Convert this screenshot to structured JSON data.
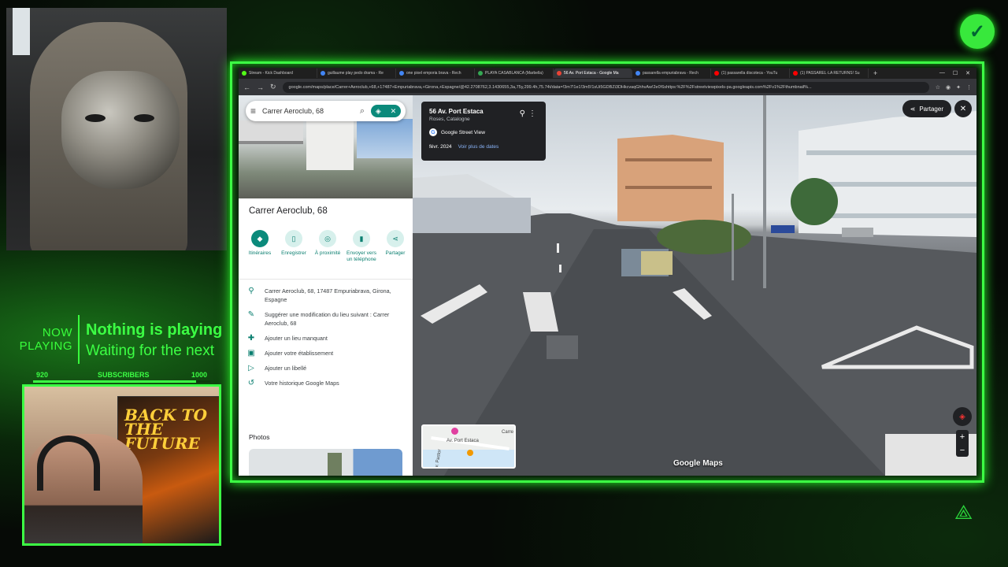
{
  "overlay": {
    "now_playing_label": "NOW PLAYING",
    "now_playing_title": "Nothing is playing",
    "now_playing_sub": "Waiting for the next",
    "subs": {
      "current": "920",
      "label": "SUBSCRIBERS",
      "goal": "1000",
      "progress": 0.92
    },
    "poster_title": "BACK TO THE FUTURE"
  },
  "browser": {
    "tabs": [
      {
        "label": "Stream - Kick Dashboard",
        "color": "#53fc18"
      },
      {
        "label": "guillaume play pedo drama - Re",
        "color": "#4285f4"
      },
      {
        "label": "one pixel emporia brava - Rech",
        "color": "#4285f4"
      },
      {
        "label": "PLAYA CASABLANCA (Marbella)",
        "color": "#34a853"
      },
      {
        "label": "56 Av. Port Estaca - Google Ma",
        "color": "#ea4335",
        "active": true
      },
      {
        "label": "passarella empuriabrava - Rech",
        "color": "#4285f4"
      },
      {
        "label": "(1) passarella discoteca - YouTu",
        "color": "#ff0000"
      },
      {
        "label": "(1) PASSAREL·LA RETURNS! Su",
        "color": "#ff0000"
      }
    ],
    "new_tab": "+",
    "url": "google.com/maps/place/Carrer+Aeroclub,+68,+17487+Empuriabrava,+Girona,+Espagne/@42.2708762,3.1430655,3a,75y,299.4h,75.74t/data=!3m7!1e1!3m5!1sUi5GDBZi3DHkcvaqGhhvAw!2e0!6shttps:%2F%2Fstreetviewpixels-pa.googleapis.com%2Fv1%2Fthumbnail%..."
  },
  "panel": {
    "search_query": "Carrer Aeroclub, 68",
    "place_title": "Carrer Aeroclub, 68",
    "actions": [
      {
        "label": "Itinéraires",
        "icon": "directions-icon",
        "glyph": "◆",
        "primary": true
      },
      {
        "label": "Enregistrer",
        "icon": "bookmark-icon",
        "glyph": "▯"
      },
      {
        "label": "À proximité",
        "icon": "nearby-icon",
        "glyph": "◎"
      },
      {
        "label": "Envoyer vers un téléphone",
        "icon": "phone-icon",
        "glyph": "▮"
      },
      {
        "label": "Partager",
        "icon": "share-icon",
        "glyph": "⋖"
      }
    ],
    "info": [
      {
        "icon": "pin-icon",
        "glyph": "⚲",
        "text": "Carrer Aeroclub, 68, 17487 Empuriabrava, Girona, Espagne"
      },
      {
        "icon": "edit-icon",
        "glyph": "✎",
        "text": "Suggérer une modification du lieu suivant : Carrer Aeroclub, 68"
      },
      {
        "icon": "add-place-icon",
        "glyph": "✚",
        "text": "Ajouter un lieu manquant"
      },
      {
        "icon": "business-icon",
        "glyph": "▣",
        "text": "Ajouter votre établissement"
      },
      {
        "icon": "label-icon",
        "glyph": "▷",
        "text": "Ajouter un libellé"
      },
      {
        "icon": "history-icon",
        "glyph": "↺",
        "text": "Votre historique Google Maps"
      }
    ],
    "photos_heading": "Photos"
  },
  "streetview": {
    "address": "56 Av. Port Estaca",
    "locality": "Roses, Catalogne",
    "provider": "Google Street View",
    "date": "févr. 2024",
    "dates_link": "Voir plus de dates",
    "share_label": "Partager",
    "watermark": "Google Maps",
    "minimap_labels": {
      "road": "Av. Port Estaca",
      "side": "Av. Pastor",
      "edge": "Carre"
    }
  },
  "colors": {
    "overlay_green": "#3cff44",
    "maps_teal": "#0b8a7b",
    "sv_card": "#202124"
  }
}
